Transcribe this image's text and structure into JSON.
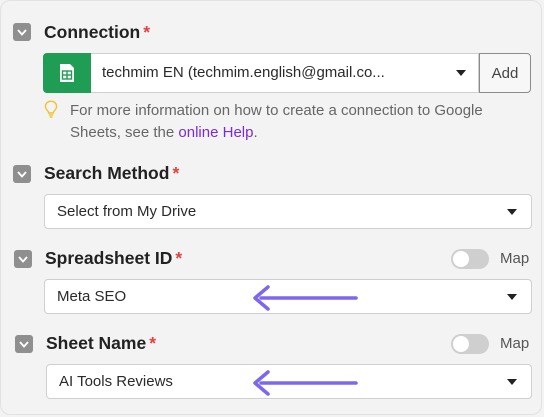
{
  "connection": {
    "label": "Connection",
    "required_mark": "*",
    "selected": "techmim EN (techmim.english@gmail.co...",
    "add_label": "Add",
    "app_icon": "google-sheets-icon",
    "hint_text": "For more information on how to create a connection to Google Sheets, see the ",
    "hint_link": "online Help",
    "hint_end": "."
  },
  "search_method": {
    "label": "Search Method",
    "required_mark": "*",
    "selected": "Select from My Drive"
  },
  "spreadsheet_id": {
    "label": "Spreadsheet ID",
    "required_mark": "*",
    "map_label": "Map",
    "selected": "Meta SEO"
  },
  "sheet_name": {
    "label": "Sheet Name",
    "required_mark": "*",
    "map_label": "Map",
    "selected": "AI Tools Reviews"
  },
  "colors": {
    "accent_arrow": "#7b68ee",
    "link": "#7a2bd6",
    "required": "#e0433e",
    "sheets_green": "#1f9d55"
  }
}
